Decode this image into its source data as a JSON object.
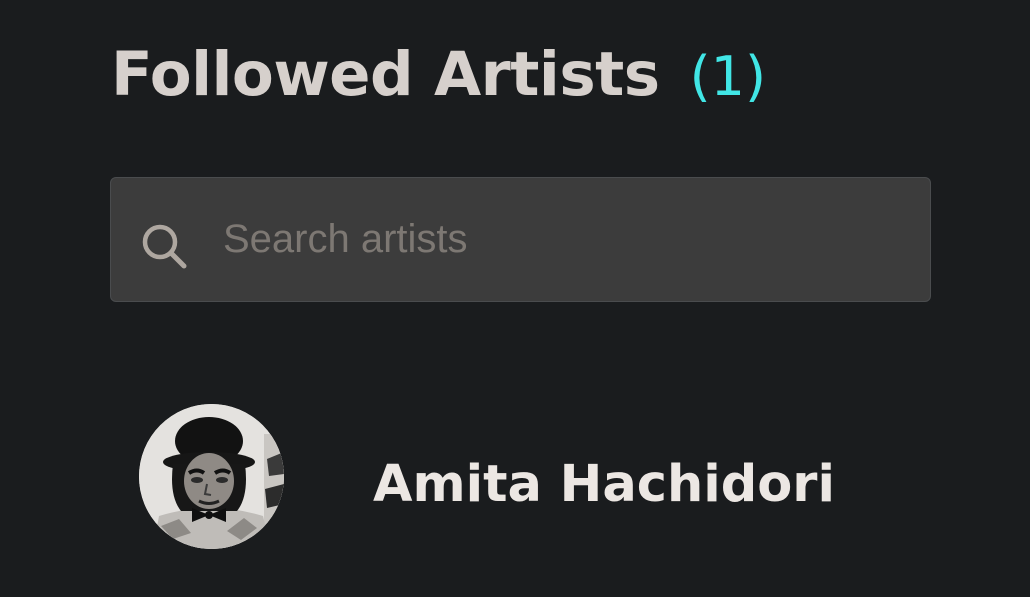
{
  "header": {
    "title": "Followed Artists",
    "count": "(1)"
  },
  "search": {
    "icon": "search-icon",
    "placeholder": "Search artists",
    "value": ""
  },
  "artists": [
    {
      "name": "Amita Hachidori",
      "avatar": "avatar-photo"
    }
  ],
  "colors": {
    "background": "#1a1c1e",
    "title": "#d6d0cc",
    "count_accent": "#41e6e6",
    "search_background": "#3c3c3c",
    "placeholder": "#7d7873",
    "artist_name": "#ece7e3"
  }
}
